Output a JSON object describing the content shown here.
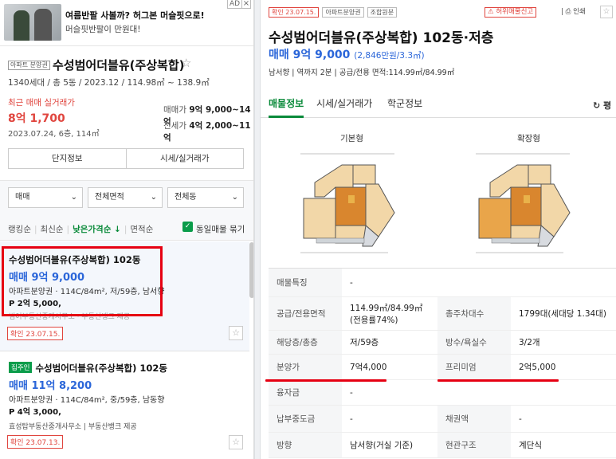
{
  "ad": {
    "title": "여름반팔 사볼까? 허그본 머슬핏으로!",
    "subtitle": "머슬핏반팔이 만원대!",
    "badge": "AD",
    "close": "×"
  },
  "complex": {
    "tag": "아파트 분양권",
    "name": "수성범어더블유(주상복합)",
    "info": "1340세대 / 총 5동 / 2023.12 / 114.98㎡ ~ 138.9㎡",
    "recent_label": "최근 매매 실거래가",
    "recent_price": "8억 1,700",
    "recent_date": "2023.07.24, 6층, 114㎡",
    "sale_label": "매매가",
    "sale_range": "9억 9,000~14억",
    "rent_label": "전세가",
    "rent_range": "4억 2,000~11억",
    "btn_info": "단지정보",
    "btn_price": "시세/실거래가"
  },
  "filters": {
    "type": "매매",
    "area": "전체면적",
    "dong": "전체동",
    "sort_ranking": "랭킹순",
    "sort_new": "최신순",
    "sort_low": "낮은가격순 ↓",
    "sort_area": "면적순",
    "same_listing": "동일매물 묶기"
  },
  "listings": [
    {
      "title": "수성범어더블유(주상복합) 102동",
      "price": "매매 9억 9,000",
      "desc": "아파트분양권 · 114C/84m², 저/59층, 남서향",
      "premium": "P 2억 5,000,",
      "agent": "범어부동산중개사무소 · 부동산뱅크 제공",
      "confirm": "확인 23.07.15."
    },
    {
      "badge": "집주인",
      "title": "수성범어더블유(주상복합) 102동",
      "price": "매매 11억 8,200",
      "desc": "아파트분양권 · 114C/84m², 중/59층, 남동향",
      "premium": "P 4억 3,000,",
      "agent": "효성탑부동산중개사무소 | 부동산뱅크 제공",
      "confirm": "확인 23.07.13."
    }
  ],
  "detail": {
    "tag_confirm": "확인 23.07.15.",
    "tag_type": "아파트분양권",
    "tag_union": "조합원분",
    "report": "허위매물신고",
    "print": "인쇄",
    "title": "수성범어더블유(주상복합) 102동·저층",
    "price": "매매 9억 9,000",
    "price_per": "(2,846만원/3.3㎡)",
    "info": "남서향 | 역까지 2분 | 공급/전용 면적:114.99㎡/84.99㎡",
    "tabs": [
      "매물정보",
      "시세/실거래가",
      "학군정보"
    ],
    "refresh": "↻ 평",
    "fp_basic": "기본형",
    "fp_ext": "확장형",
    "specs": [
      {
        "h1": "매물특징",
        "v1": "-",
        "h2": "",
        "v2": ""
      },
      {
        "h1": "공급/전용면적",
        "v1": "114.99㎡/84.99㎡(전용률74%)",
        "h2": "총주차대수",
        "v2": "1799대(세대당 1.34대)"
      },
      {
        "h1": "해당층/총층",
        "v1": "저/59층",
        "h2": "방수/욕실수",
        "v2": "3/2개"
      },
      {
        "h1": "분양가",
        "v1": "7억4,000",
        "h2": "프리미엄",
        "v2": "2억5,000"
      },
      {
        "h1": "융자금",
        "v1": "-",
        "h2": "",
        "v2": ""
      },
      {
        "h1": "납부중도금",
        "v1": "-",
        "h2": "채권액",
        "v2": "-"
      },
      {
        "h1": "방향",
        "v1": "남서향(거실 기준)",
        "h2": "현관구조",
        "v2": "계단식"
      }
    ]
  },
  "colors": {
    "accent_green": "#0a8a3a",
    "price_blue": "#2b66d9",
    "alert_red": "#e0463f",
    "highlight": "#e60012"
  }
}
